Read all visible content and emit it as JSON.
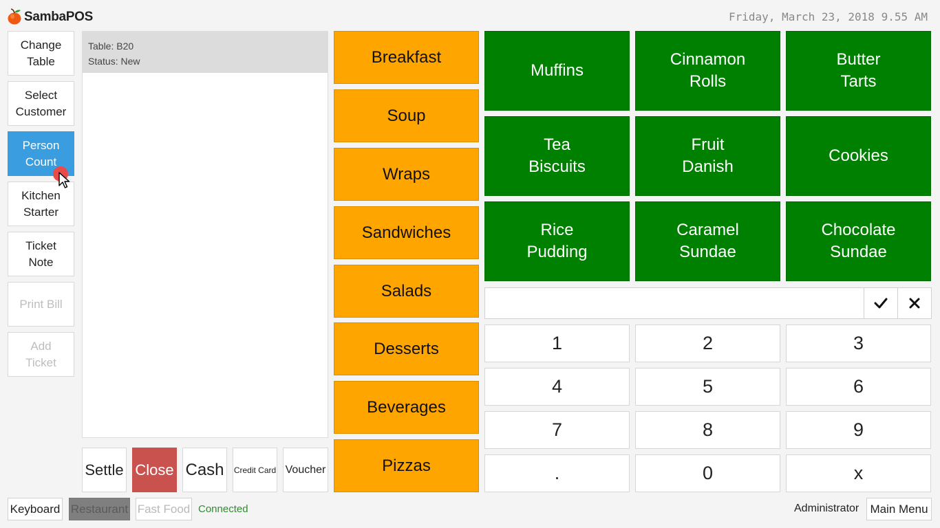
{
  "header": {
    "app_title": "SambaPOS",
    "datetime": "Friday, March 23, 2018 9.55 AM"
  },
  "side_buttons": [
    {
      "label": "Change\nTable"
    },
    {
      "label": "Select\nCustomer"
    },
    {
      "label": "Person\nCount"
    },
    {
      "label": "Kitchen\nStarter"
    },
    {
      "label": "Ticket\nNote"
    },
    {
      "label": "Print Bill"
    },
    {
      "label": "Add\nTicket"
    }
  ],
  "ticket": {
    "table_line": "Table: B20",
    "status_line": "Status: New"
  },
  "payment_buttons": [
    "Settle",
    "Close",
    "Cash",
    "Credit Card",
    "Voucher"
  ],
  "categories": [
    "Breakfast",
    "Soup",
    "Wraps",
    "Sandwiches",
    "Salads",
    "Desserts",
    "Beverages",
    "Pizzas"
  ],
  "menu_items": [
    "Muffins",
    "Cinnamon\nRolls",
    "Butter\nTarts",
    "Tea\nBiscuits",
    "Fruit\nDanish",
    "Cookies",
    "Rice\nPudding",
    "Caramel\nSundae",
    "Chocolate\nSundae"
  ],
  "numpad": {
    "input_value": "",
    "keys": [
      "1",
      "2",
      "3",
      "4",
      "5",
      "6",
      "7",
      "8",
      "9",
      ".",
      "0",
      "x"
    ]
  },
  "footer": {
    "keyboard": "Keyboard",
    "restaurant": "Restaurant",
    "fast_food": "Fast Food",
    "status": "Connected",
    "user": "Administrator",
    "main_menu": "Main Menu"
  },
  "colors": {
    "category": "#ffa500",
    "menu_item": "#008000",
    "active_button": "#3a9ddf",
    "close_button": "#c9524f",
    "connected": "#2f8c2f"
  },
  "icons": {
    "logo": "apple-logo-icon",
    "confirm": "check-icon",
    "cancel": "close-icon",
    "cursor": "mouse-pointer-icon"
  }
}
